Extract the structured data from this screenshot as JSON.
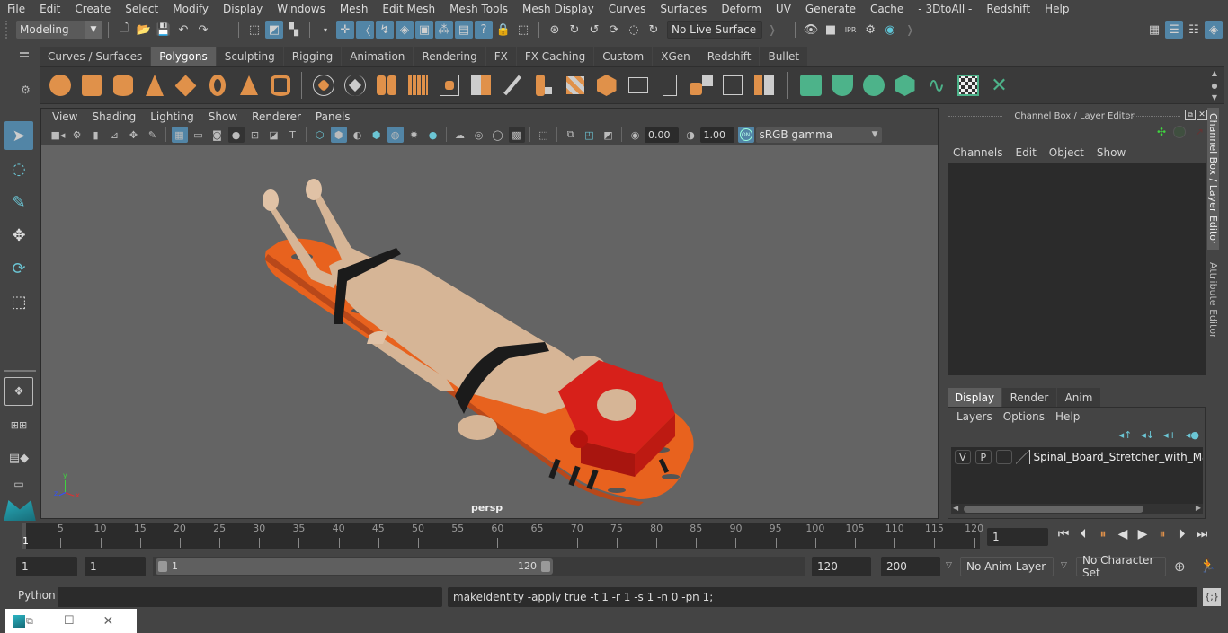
{
  "menu": [
    "File",
    "Edit",
    "Create",
    "Select",
    "Modify",
    "Display",
    "Windows",
    "Mesh",
    "Edit Mesh",
    "Mesh Tools",
    "Mesh Display",
    "Curves",
    "Surfaces",
    "Deform",
    "UV",
    "Generate",
    "Cache",
    "- 3DtoAll -",
    "Redshift",
    "Help"
  ],
  "status_line": {
    "workspace": "Modeling",
    "live_surface": "No Live Surface",
    "icons": [
      "new-scene-icon",
      "open-scene-icon",
      "save-scene-icon",
      "undo-icon",
      "redo-icon",
      "select-hierarchy-icon",
      "select-object-icon",
      "select-component-icon",
      "snap-grid-icon",
      "snap-curve-icon",
      "snap-point-icon",
      "snap-projected-icon",
      "snap-view-plane-icon",
      "make-live-icon",
      "snap-settings-icon",
      "help-icon",
      "lock-icon",
      "selection-mask-icon"
    ],
    "render_icons": [
      "render-view-icon",
      "render-current-icon",
      "ipr-render-icon",
      "render-settings-icon",
      "hypershade-icon"
    ]
  },
  "shelf": {
    "tabs": [
      "Curves / Surfaces",
      "Polygons",
      "Sculpting",
      "Rigging",
      "Animation",
      "Rendering",
      "FX",
      "FX Caching",
      "Custom",
      "XGen",
      "Redshift",
      "Bullet"
    ],
    "active_tab": "Polygons",
    "orange_icons": [
      "poly-sphere-icon",
      "poly-cube-icon",
      "poly-cylinder-icon",
      "poly-cone-icon",
      "poly-diamond-icon",
      "poly-torus-icon",
      "poly-pyramid-icon",
      "poly-pipe-icon"
    ],
    "tool_icons": [
      "combine-icon",
      "separate-icon",
      "mirror-icon",
      "smooth-icon",
      "extrude-icon",
      "bevel-icon",
      "bridge-icon",
      "multicut-icon",
      "extrude-face-icon",
      "merge-icon",
      "append-icon",
      "insert-edge-loop-icon",
      "offset-loop-icon",
      "fill-hole-icon",
      "target-weld-icon",
      "quadrangulate-icon"
    ],
    "uv_icons": [
      "planar-map-icon",
      "cylindrical-map-icon",
      "spherical-map-icon",
      "automatic-map-icon",
      "unfold-icon",
      "uv-editor-icon",
      "sew-uv-icon"
    ]
  },
  "viewport": {
    "menus": [
      "View",
      "Shading",
      "Lighting",
      "Show",
      "Renderer",
      "Panels"
    ],
    "exposure": "0.00",
    "gamma": "1.00",
    "color_toggle": "ON",
    "color_space": "sRGB gamma",
    "camera_label": "persp",
    "axis": {
      "x": "x",
      "y": "y",
      "z": "z"
    }
  },
  "channel_box": {
    "title": "Channel Box / Layer Editor",
    "menus": [
      "Channels",
      "Edit",
      "Object",
      "Show"
    ]
  },
  "layer_editor": {
    "tabs": [
      "Display",
      "Render",
      "Anim"
    ],
    "active_tab": "Display",
    "menus": [
      "Layers",
      "Options",
      "Help"
    ],
    "layers": [
      {
        "v": "V",
        "p": "P",
        "name": "Spinal_Board_Stretcher_with_Manikin"
      }
    ]
  },
  "side_tabs": [
    "Channel Box / Layer Editor",
    "Attribute Editor"
  ],
  "timeline": {
    "ticks": [
      5,
      10,
      15,
      20,
      25,
      30,
      35,
      40,
      45,
      50,
      55,
      60,
      65,
      70,
      75,
      80,
      85,
      90,
      95,
      100,
      105,
      110,
      115,
      120
    ],
    "current_frame_marker": "1",
    "current_frame": "1"
  },
  "range": {
    "start": "1",
    "playback_start": "1",
    "slider_start": "1",
    "slider_end": "120",
    "playback_end": "120",
    "end": "200",
    "anim_layer": "No Anim Layer",
    "character_set": "No Character Set"
  },
  "command_line": {
    "language": "Python",
    "input": "",
    "result": "makeIdentity -apply true -t 1 -r 1 -s 1 -n 0 -pn 1;"
  },
  "colors": {
    "accent": "#5285a6",
    "shelf_orange": "#e0914a",
    "shelf_green": "#4db38a",
    "stretcher": "#e8621e",
    "head_block": "#d7201a",
    "skin": "#d6b596"
  }
}
